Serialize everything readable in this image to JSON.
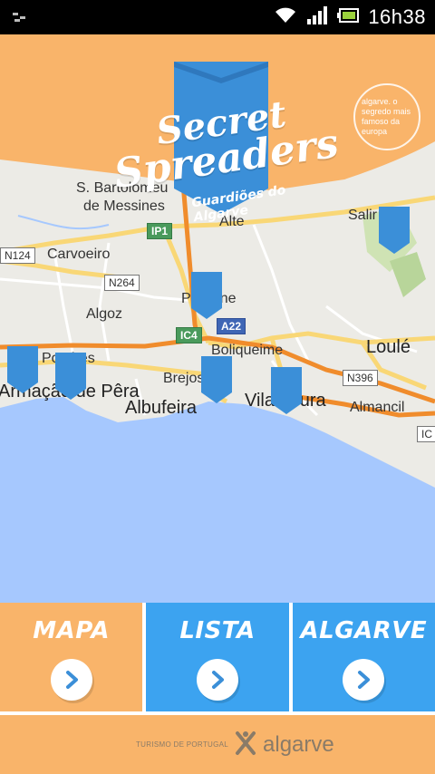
{
  "status_bar": {
    "time": "16h38",
    "icons": [
      "usb-icon",
      "wifi-icon",
      "signal-icon",
      "battery-icon"
    ]
  },
  "header": {
    "title_line1": "Secret",
    "title_line2": "Spreaders",
    "subtitle": "Guardiões do Algarve",
    "badge_text": "algarve. o segredo mais famoso da europa",
    "colors": {
      "orange": "#f9b46a",
      "shield_blue": "#3b8fd8"
    }
  },
  "map": {
    "places": [
      "S. Bartolomeu",
      "de Messines",
      "Alte",
      "Salir",
      "Carvoeiro",
      "Algoz",
      "Paderne",
      "Boliqueime",
      "Loulé",
      "Armação de Pêra",
      "Porches",
      "Brejos",
      "Albufeira",
      "Vilamoura",
      "Almancil"
    ],
    "roads": [
      "N124",
      "IP1",
      "N264",
      "A22",
      "IC4",
      "N396",
      "IC"
    ],
    "pins_count": 6,
    "colors": {
      "land": "#ecebe6",
      "sea": "#a6c8fe",
      "highway": "#f08c2c",
      "road": "#f9d776",
      "pin": "#3b8fd8"
    }
  },
  "tiles": [
    {
      "label": "MAPA",
      "color": "#f9b46a"
    },
    {
      "label": "LISTA",
      "color": "#3ca3f0"
    },
    {
      "label": "ALGARVE",
      "color": "#3ca3f0"
    }
  ],
  "footer": {
    "small_text": "TURISMO DE PORTUGAL",
    "brand": "algarve"
  }
}
